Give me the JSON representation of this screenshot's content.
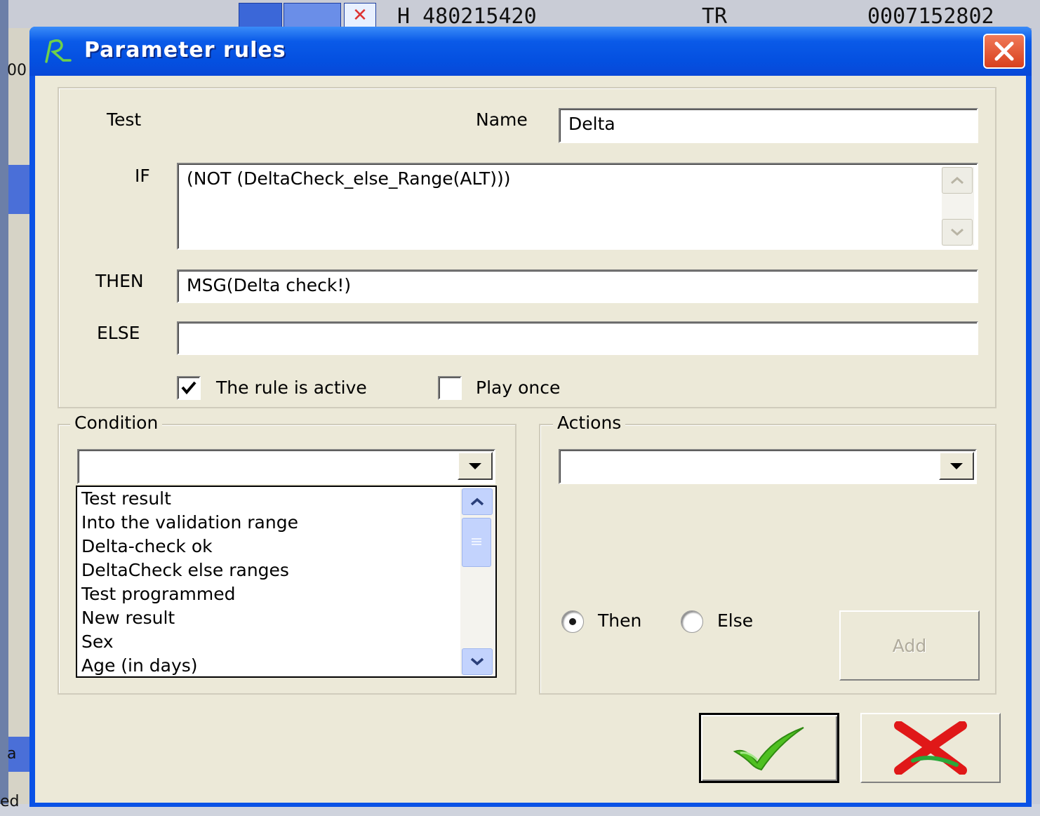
{
  "background": {
    "frag_top_left": "00",
    "frag_mid1": "H 480215420",
    "frag_mid2": "TR",
    "frag_right": "0007152802",
    "frag_bottom_left_a": "a",
    "frag_bottom_left_b": "ed"
  },
  "window": {
    "title": "Parameter rules",
    "icon": "app-logo-icon",
    "close_icon": "close-icon"
  },
  "form": {
    "test_label": "Test",
    "name_label": "Name",
    "name_value": "Delta",
    "if_label": "IF",
    "if_value": "(NOT (DeltaCheck_else_Range(ALT)))",
    "then_label": "THEN",
    "then_value": "MSG(Delta check!)",
    "else_label": "ELSE",
    "else_value": "",
    "active_label": "The rule is active",
    "active_checked": true,
    "play_once_label": "Play once",
    "play_once_checked": false
  },
  "condition": {
    "legend": "Condition",
    "combo_value": "",
    "items": [
      "Test result",
      "Into the validation range",
      "Delta-check ok",
      "DeltaCheck else ranges",
      "Test programmed",
      "New result",
      "Sex",
      "Age (in days)"
    ]
  },
  "actions": {
    "legend": "Actions",
    "combo_value": "",
    "then_label": "Then",
    "else_label": "Else",
    "selected": "Then",
    "add_label": "Add"
  },
  "buttons": {
    "ok_icon": "checkmark-icon",
    "cancel_icon": "cross-icon"
  },
  "colors": {
    "titlebar": "#0a5ae8",
    "client": "#ece9d8",
    "ok_green": "#4fc021",
    "cancel_red": "#e01818"
  }
}
